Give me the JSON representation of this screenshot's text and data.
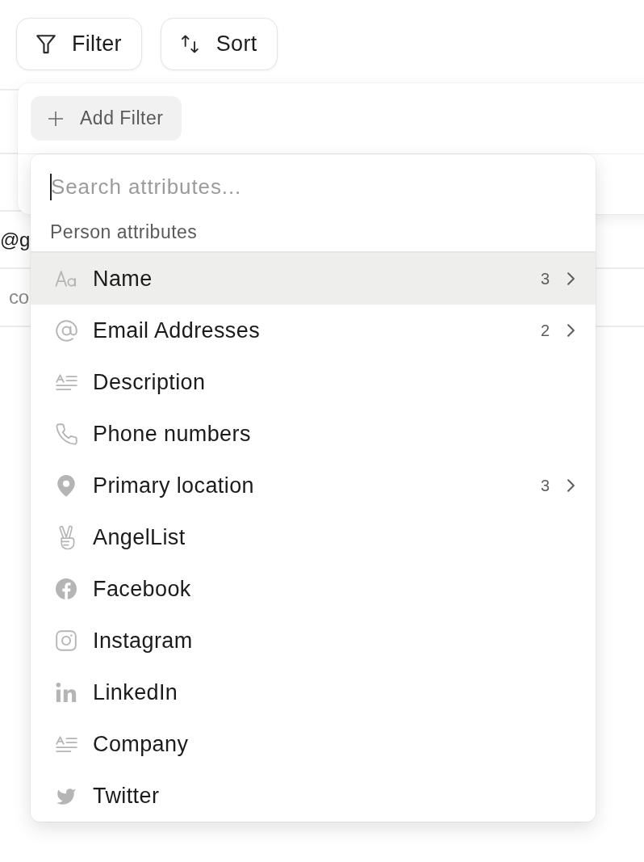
{
  "toolbar": {
    "buttons": [
      {
        "label": "Filter",
        "kind": "filter"
      },
      {
        "label": "Sort",
        "kind": "sort"
      }
    ]
  },
  "table": {
    "rows": [
      {
        "column_1": "@g",
        "kind": "value"
      },
      {
        "column_1": "co",
        "kind": "hint"
      }
    ]
  },
  "filter_panel": {
    "add_button": {
      "label": "Add Filter"
    }
  },
  "attribute_menu": {
    "search": {
      "placeholder": "Search attributes...",
      "focused": true
    },
    "section": "Person attributes",
    "items": [
      {
        "label": "Name",
        "kind": "text",
        "count": "3",
        "submenu": true,
        "selected": true
      },
      {
        "label": "Email Addresses",
        "kind": "email",
        "count": "2",
        "submenu": true,
        "selected": false
      },
      {
        "label": "Description",
        "kind": "longtext",
        "submenu": false,
        "selected": false
      },
      {
        "label": "Phone numbers",
        "kind": "phone",
        "submenu": false,
        "selected": false
      },
      {
        "label": "Primary location",
        "kind": "location",
        "count": "3",
        "submenu": true,
        "selected": false
      },
      {
        "label": "AngelList",
        "kind": "angellist",
        "submenu": false,
        "selected": false
      },
      {
        "label": "Facebook",
        "kind": "facebook",
        "submenu": false,
        "selected": false
      },
      {
        "label": "Instagram",
        "kind": "instagram",
        "submenu": false,
        "selected": false
      },
      {
        "label": "LinkedIn",
        "kind": "linkedin",
        "submenu": false,
        "selected": false
      },
      {
        "label": "Company",
        "kind": "longtext",
        "submenu": false,
        "selected": false
      },
      {
        "label": "Twitter",
        "kind": "twitter",
        "submenu": false,
        "selected": false
      }
    ]
  }
}
